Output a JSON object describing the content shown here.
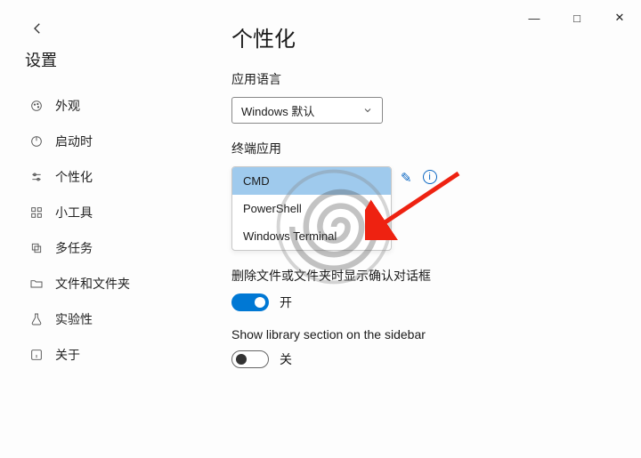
{
  "window": {
    "minimize": "—",
    "maximize": "□",
    "close": "✕"
  },
  "back_label": "返回",
  "settings_title": "设置",
  "nav": [
    {
      "key": "appearance",
      "label": "外观"
    },
    {
      "key": "startup",
      "label": "启动时"
    },
    {
      "key": "personalize",
      "label": "个性化"
    },
    {
      "key": "widgets",
      "label": "小工具"
    },
    {
      "key": "multitask",
      "label": "多任务"
    },
    {
      "key": "files",
      "label": "文件和文件夹"
    },
    {
      "key": "experimental",
      "label": "实验性"
    },
    {
      "key": "about",
      "label": "关于"
    }
  ],
  "page_title": "个性化",
  "lang": {
    "label": "应用语言",
    "selected": "Windows 默认"
  },
  "terminal": {
    "label": "终端应用",
    "options": [
      "CMD",
      "PowerShell",
      "Windows Terminal"
    ],
    "selected_index": 0,
    "edit_icon_name": "edit-icon",
    "info_icon_name": "info-icon"
  },
  "delete_confirm": {
    "label": "删除文件或文件夹时显示确认对话框",
    "state": true,
    "state_text": "开"
  },
  "library_sidebar": {
    "label": "Show library section on the sidebar",
    "state": false,
    "state_text": "关"
  }
}
